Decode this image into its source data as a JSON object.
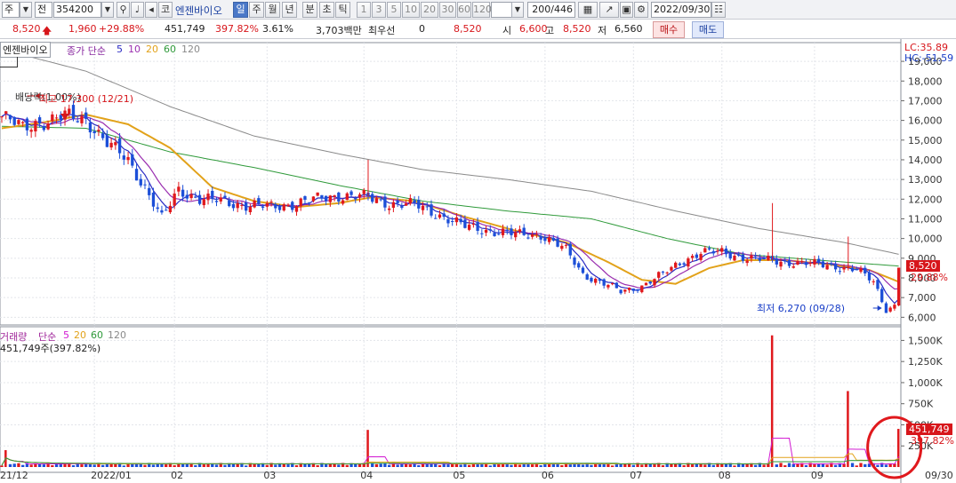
{
  "toolbar": {
    "market_label": "주",
    "jeon_label": "전",
    "code_value": "354200",
    "ko_label": "코",
    "stock_name": "엔젠바이오",
    "period_buttons": [
      "일",
      "주",
      "월",
      "년",
      "분",
      "초",
      "틱"
    ],
    "interval_buttons": [
      "1",
      "3",
      "5",
      "10",
      "20",
      "30",
      "60",
      "120"
    ],
    "count_value": "200/446",
    "date_value": "2022/09/30"
  },
  "quote": {
    "price": "8,520",
    "change": "1,960",
    "change_pct": "+29.88%",
    "volume": "451,749",
    "volume_ratio": "397.82%",
    "turnover": "3.61%",
    "amount": "3,703백만",
    "best_ask_label": "최우선",
    "best_ask_value": "0",
    "current_value": "8,520",
    "open_label": "시",
    "open_value": "6,600",
    "high_label": "고",
    "high_value": "8,520",
    "low_label": "저",
    "low_value": "6,560",
    "buy_label": "매수",
    "sell_label": "매도"
  },
  "price_pane": {
    "title": "엔젠바이오",
    "legend_prefix": "종가 단순",
    "ma_labels": [
      "5",
      "10",
      "20",
      "60",
      "120"
    ],
    "ma_colors": [
      "#2b2bc4",
      "#9a2fb0",
      "#e2a21a",
      "#2f9a3a",
      "#8a8a8a"
    ],
    "lc_label": "LC:35.89",
    "hc_label": "HC:-51.59",
    "dividend_annotation": "배당락(1.00%)",
    "high_annotation": "최고 17,300 (12/21)",
    "low_annotation": "최저 6,270 (09/28)",
    "last_price_tag": "8,520",
    "last_change_tag": "29.88%"
  },
  "volume_pane": {
    "title": "거래량",
    "legend_prefix": "단순",
    "ma_labels": [
      "5",
      "20",
      "60",
      "120"
    ],
    "ma_colors": [
      "#d21bd2",
      "#e2a21a",
      "#2f9a3a",
      "#8a8a8a"
    ],
    "subtitle": "451,749주(397.82%)",
    "last_volume_tag": "451,749",
    "last_ratio_tag": "397.82%"
  },
  "x_axis_labels": [
    "21/12",
    "2022/01",
    "02",
    "03",
    "04",
    "05",
    "06",
    "07",
    "08",
    "09",
    "09/30"
  ],
  "chart_data": [
    {
      "type": "candlestick",
      "series": [
        {
          "name": "5",
          "role": "ma"
        },
        {
          "name": "10",
          "role": "ma"
        },
        {
          "name": "20",
          "role": "ma"
        },
        {
          "name": "60",
          "role": "ma"
        },
        {
          "name": "120",
          "role": "ma"
        }
      ],
      "y_ticks": [
        "19,000",
        "18,000",
        "17,000",
        "16,000",
        "15,000",
        "14,000",
        "13,000",
        "12,000",
        "11,000",
        "10,000",
        "9,000",
        "8,000",
        "7,000",
        "6,000"
      ],
      "ylim": [
        5700,
        19500
      ],
      "x_anchors": [
        {
          "label": "21/12",
          "index": 0
        },
        {
          "label": "2022/01",
          "index": 22
        },
        {
          "label": "02",
          "index": 41
        },
        {
          "label": "03",
          "index": 63
        },
        {
          "label": "04",
          "index": 86
        },
        {
          "label": "05",
          "index": 108
        },
        {
          "label": "06",
          "index": 129
        },
        {
          "label": "07",
          "index": 150
        },
        {
          "label": "08",
          "index": 171
        },
        {
          "label": "09",
          "index": 193
        },
        {
          "label": "09/30",
          "index": 213
        }
      ],
      "close_path": [
        [
          0,
          16200
        ],
        [
          5,
          15600
        ],
        [
          8,
          15900
        ],
        [
          12,
          16000
        ],
        [
          15,
          16200
        ],
        [
          20,
          16100
        ],
        [
          25,
          14800
        ],
        [
          30,
          14000
        ],
        [
          34,
          12600
        ],
        [
          38,
          11000
        ],
        [
          42,
          12500
        ],
        [
          47,
          12000
        ],
        [
          52,
          11900
        ],
        [
          58,
          11700
        ],
        [
          64,
          11600
        ],
        [
          70,
          11800
        ],
        [
          75,
          12000
        ],
        [
          80,
          12200
        ],
        [
          86,
          12100
        ],
        [
          92,
          11800
        ],
        [
          98,
          11700
        ],
        [
          104,
          11200
        ],
        [
          110,
          10600
        ],
        [
          116,
          10400
        ],
        [
          122,
          10200
        ],
        [
          128,
          10200
        ],
        [
          134,
          9400
        ],
        [
          138,
          8200
        ],
        [
          142,
          7800
        ],
        [
          147,
          7300
        ],
        [
          152,
          7600
        ],
        [
          157,
          8200
        ],
        [
          162,
          8900
        ],
        [
          166,
          9300
        ],
        [
          171,
          9300
        ],
        [
          175,
          9100
        ],
        [
          181,
          8900
        ],
        [
          187,
          8800
        ],
        [
          193,
          8700
        ],
        [
          198,
          8600
        ],
        [
          203,
          8400
        ],
        [
          207,
          7800
        ],
        [
          210,
          6400
        ],
        [
          212,
          6600
        ],
        [
          213,
          8520
        ]
      ],
      "ma_paths": {
        "20": [
          [
            0,
            15600
          ],
          [
            10,
            15900
          ],
          [
            20,
            16300
          ],
          [
            30,
            15800
          ],
          [
            40,
            14600
          ],
          [
            50,
            12600
          ],
          [
            60,
            11900
          ],
          [
            70,
            11600
          ],
          [
            80,
            11800
          ],
          [
            88,
            12100
          ],
          [
            98,
            11900
          ],
          [
            110,
            11100
          ],
          [
            122,
            10400
          ],
          [
            134,
            9800
          ],
          [
            144,
            8800
          ],
          [
            152,
            7900
          ],
          [
            160,
            7700
          ],
          [
            168,
            8500
          ],
          [
            176,
            8900
          ],
          [
            186,
            8900
          ],
          [
            196,
            8700
          ],
          [
            206,
            8400
          ],
          [
            213,
            7800
          ]
        ],
        "60": [
          [
            0,
            15700
          ],
          [
            20,
            15600
          ],
          [
            40,
            14400
          ],
          [
            60,
            13600
          ],
          [
            80,
            12700
          ],
          [
            100,
            11900
          ],
          [
            120,
            11400
          ],
          [
            140,
            11000
          ],
          [
            158,
            10000
          ],
          [
            176,
            9200
          ],
          [
            194,
            8900
          ],
          [
            213,
            8600
          ]
        ],
        "120": [
          [
            0,
            19600
          ],
          [
            20,
            18500
          ],
          [
            40,
            16700
          ],
          [
            60,
            15200
          ],
          [
            80,
            14300
          ],
          [
            100,
            13500
          ],
          [
            120,
            13000
          ],
          [
            140,
            12400
          ],
          [
            160,
            11400
          ],
          [
            180,
            10500
          ],
          [
            200,
            9800
          ],
          [
            213,
            9200
          ]
        ]
      },
      "ma_series_names": [
        "5",
        "10",
        "20",
        "60",
        "120"
      ],
      "title": "",
      "xlabel": "",
      "ylabel": ""
    },
    {
      "type": "bar",
      "y_ticks": [
        "1,500K",
        "1,250K",
        "1,000K",
        "750K",
        "500K",
        "250K"
      ],
      "ylim": [
        0,
        1620000
      ],
      "spikes": [
        {
          "index": 1,
          "value": 200000
        },
        {
          "index": 87,
          "value": 440000
        },
        {
          "index": 183,
          "value": 1560000
        },
        {
          "index": 201,
          "value": 900000
        },
        {
          "index": 213,
          "value": 451749
        }
      ],
      "baseline_volume": 35000,
      "title": "",
      "xlabel": "",
      "ylabel": ""
    }
  ]
}
